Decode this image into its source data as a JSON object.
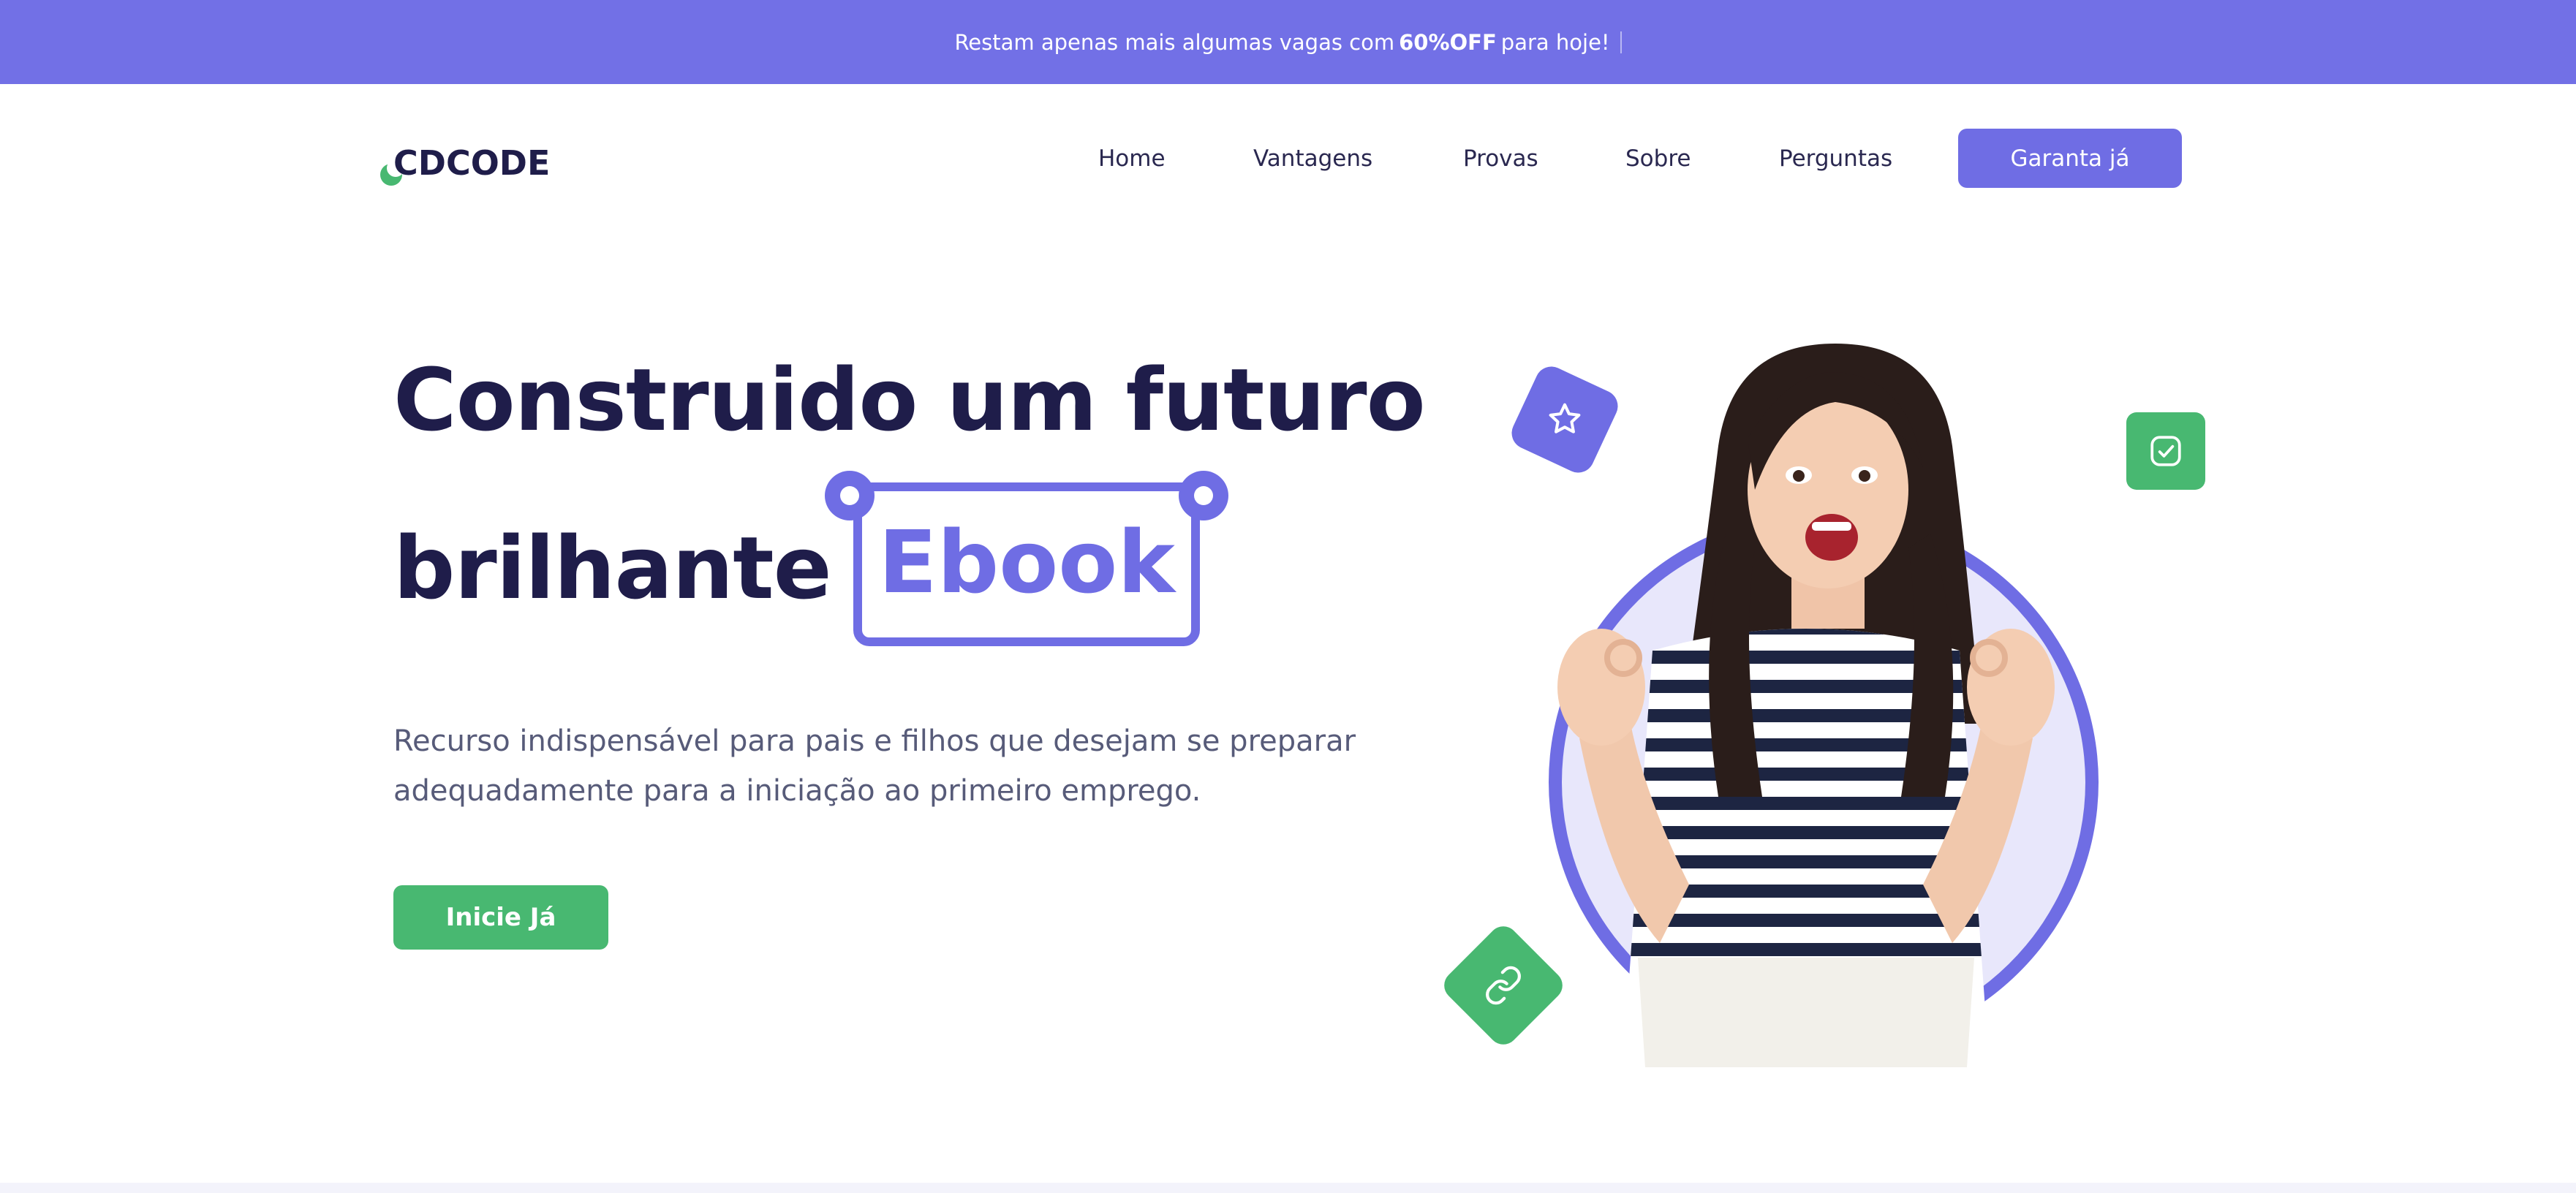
{
  "promo": {
    "before": "Restam apenas mais algumas vagas com",
    "highlight": "60%OFF",
    "after": "para hoje!"
  },
  "logo": {
    "text": "CDCODE"
  },
  "nav": {
    "items": [
      "Home",
      "Vantagens",
      "Provas",
      "Sobre",
      "Perguntas"
    ],
    "cta": "Garanta já"
  },
  "hero": {
    "title_line1": "Construido um futuro",
    "title_line2": "brilhante",
    "highlight": "Ebook",
    "description": "Recurso indispensável para pais e filhos que desejam se preparar adequadamente para a iniciação ao primeiro emprego.",
    "cta": "Inicie Já"
  },
  "icons": {
    "badge_purple": "star-icon",
    "badge_green_square": "check-icon",
    "badge_green_diamond": "link-icon"
  },
  "colors": {
    "primary": "#6f6de4",
    "accent": "#48b871",
    "heading": "#1f1d4a",
    "text": "#575b79"
  }
}
